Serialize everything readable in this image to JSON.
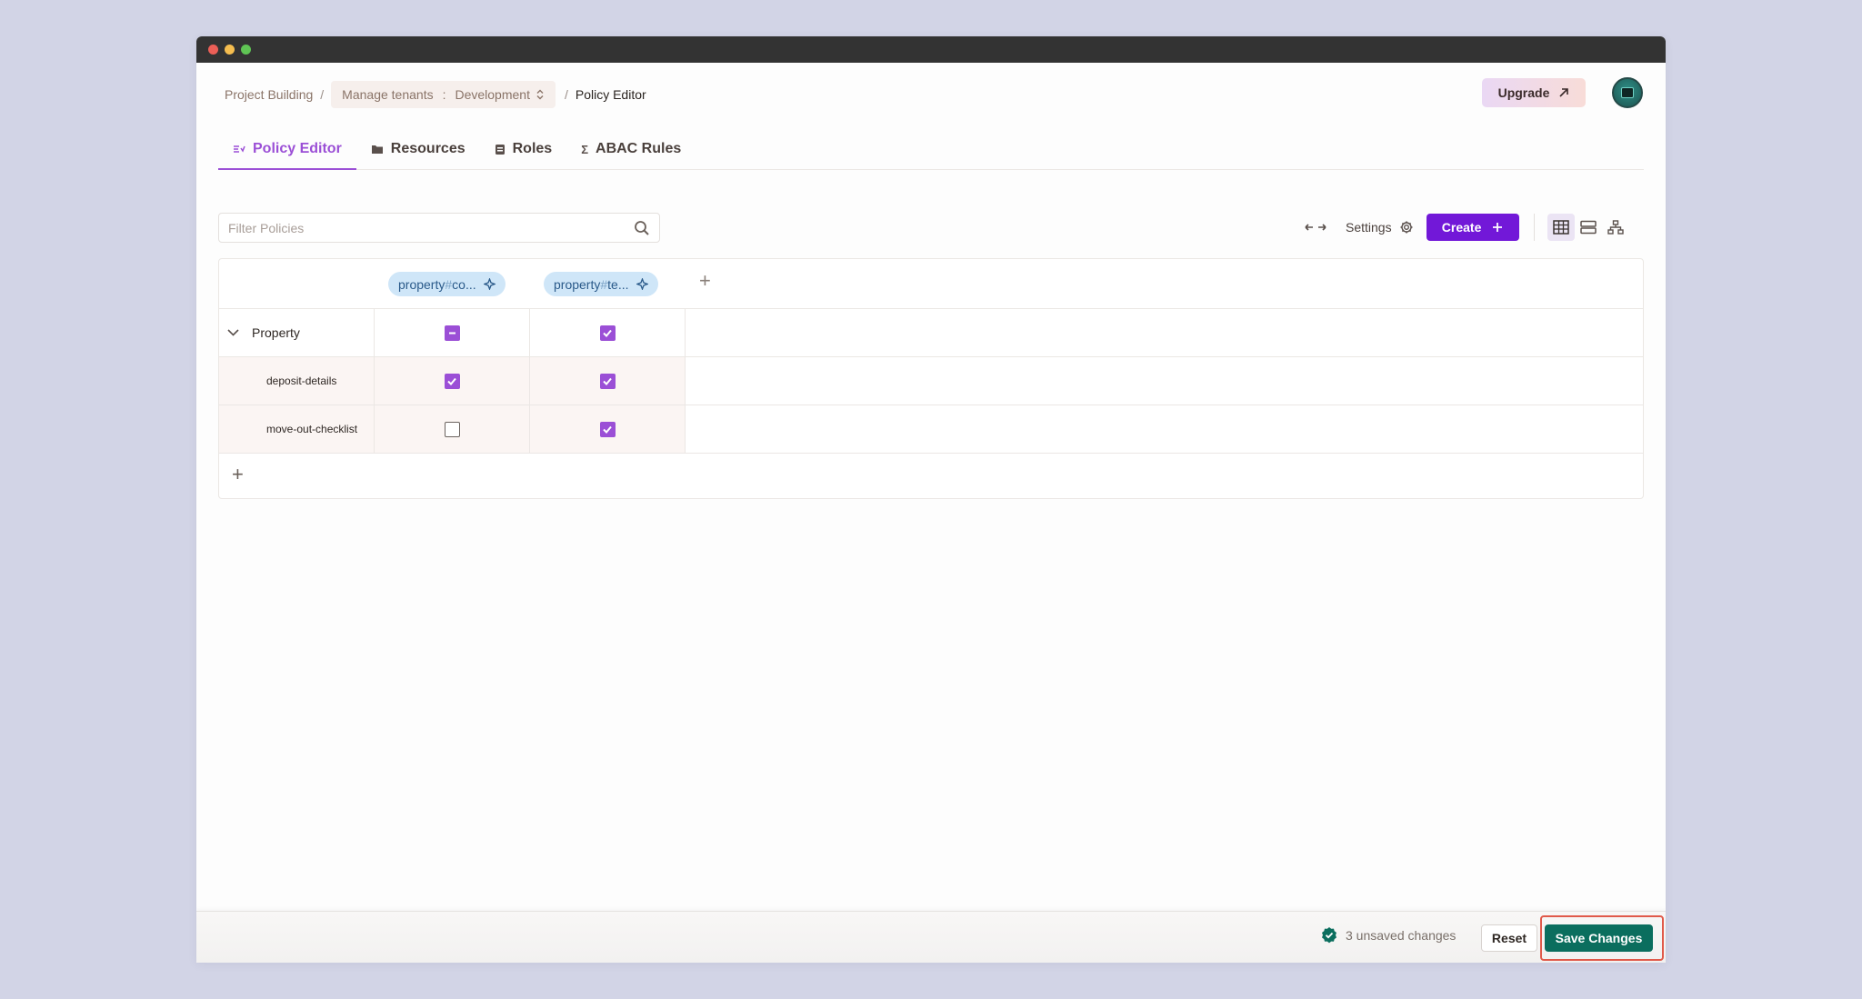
{
  "window": {
    "dots": [
      "#ec5f57",
      "#f5bd4f",
      "#5fc454"
    ]
  },
  "breadcrumb": {
    "project": "Project Building",
    "separator": "/",
    "tenant_label": "Manage tenants",
    "tenant_colon": ":",
    "environment": "Development",
    "current": "Policy Editor"
  },
  "header": {
    "upgrade_label": "Upgrade",
    "upgrade_icon": "arrow-up-right-icon",
    "avatar_icon": "terminal-avatar"
  },
  "tabs": [
    {
      "label": "Policy Editor",
      "icon": "policy-editor-icon",
      "active": true
    },
    {
      "label": "Resources",
      "icon": "folder-icon",
      "active": false
    },
    {
      "label": "Roles",
      "icon": "roles-icon",
      "active": false
    },
    {
      "label": "ABAC Rules",
      "icon": "sigma-icon",
      "active": false
    }
  ],
  "toolbar": {
    "filter_placeholder": "Filter Policies",
    "settings_label": "Settings",
    "create_label": "Create",
    "views": [
      "table-view-icon",
      "list-view-icon",
      "hierarchy-view-icon"
    ],
    "active_view": "table-view-icon"
  },
  "grid": {
    "columns": [
      {
        "prefix": "property",
        "hash": "#",
        "suffix": "co..."
      },
      {
        "prefix": "property",
        "hash": "#",
        "suffix": "te..."
      }
    ],
    "parent": {
      "label": "Property",
      "states": [
        "indeterminate",
        "checked"
      ]
    },
    "rows": [
      {
        "label": "deposit-details",
        "states": [
          "checked",
          "checked"
        ]
      },
      {
        "label": "move-out-checklist",
        "states": [
          "unchecked",
          "checked"
        ]
      }
    ]
  },
  "footer": {
    "status_text": "3 unsaved changes",
    "reset_label": "Reset",
    "save_label": "Save Changes"
  },
  "colors": {
    "accent": "#9b4fd6",
    "create": "#7218d8",
    "save": "#0b6e5e",
    "chip": "#cfe6f8"
  }
}
